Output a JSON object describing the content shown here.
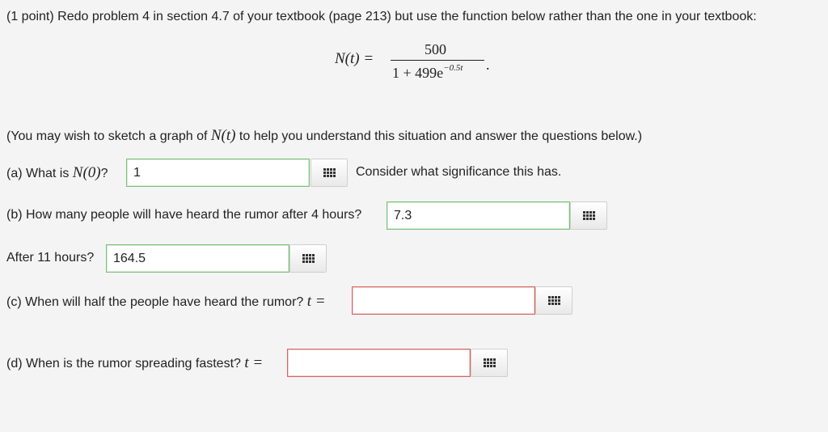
{
  "problem": {
    "intro": "(1 point) Redo problem 4 in section 4.7 of your textbook (page 213) but use the function below rather than the one in your textbook:",
    "formula": {
      "lhs": "N(t) =",
      "numerator": "500",
      "denominator_base": "1 + 499e",
      "denominator_exp": "−0.5t",
      "trailing": "."
    },
    "hint": {
      "prefix": "(You may wish to sketch a graph of ",
      "math": "N(t)",
      "suffix": " to help you understand this situation and answer the questions below.)"
    }
  },
  "parts": {
    "a": {
      "prefix": "(a) What is ",
      "math": "N(0)",
      "suffix": "?",
      "value": "1",
      "note": "Consider what significance this has."
    },
    "b": {
      "label": "(b) How many people will have heard the rumor after 4 hours?",
      "value": "7.3"
    },
    "b2": {
      "label": "After 11 hours?",
      "value": "164.5"
    },
    "c": {
      "label": "(c) When will half the people have heard the rumor?",
      "math": "t =",
      "value": ""
    },
    "d": {
      "label": "(d) When is the rumor spreading fastest?",
      "math": "t =",
      "value": ""
    }
  },
  "icons": {
    "equation_editor": "equation-grid-icon"
  },
  "colors": {
    "correct_border": "#7dc07d",
    "incorrect_border": "#d86464"
  }
}
